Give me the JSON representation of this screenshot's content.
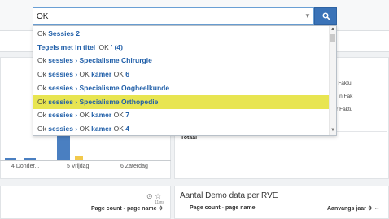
{
  "search": {
    "value": "OK",
    "caret_icon": "chevron-down-icon",
    "button_icon": "search-icon"
  },
  "suggestions": [
    {
      "parts": [
        {
          "t": "Ok ",
          "b": false
        },
        {
          "t": "Sessies 2",
          "b": true
        }
      ]
    },
    {
      "parts": [
        {
          "t": "Tegels met in titel '",
          "b": true
        },
        {
          "t": "OK",
          "b": false
        },
        {
          "t": " ' (4)",
          "b": true
        }
      ]
    },
    {
      "parts": [
        {
          "t": "Ok ",
          "b": false
        },
        {
          "t": "sessies › Specialisme Chirurgie",
          "b": true
        }
      ]
    },
    {
      "parts": [
        {
          "t": "Ok ",
          "b": false
        },
        {
          "t": "sessies › ",
          "b": true
        },
        {
          "t": "OK ",
          "b": false
        },
        {
          "t": "kamer ",
          "b": true
        },
        {
          "t": "OK ",
          "b": false
        },
        {
          "t": "6",
          "b": true
        }
      ]
    },
    {
      "parts": [
        {
          "t": "Ok ",
          "b": false
        },
        {
          "t": "sessies › Specialisme Oogheelkunde",
          "b": true
        }
      ]
    },
    {
      "parts": [
        {
          "t": "Ok ",
          "b": false
        },
        {
          "t": "sessies › Specialisme Orthopedie",
          "b": true
        }
      ],
      "highlighted": true
    },
    {
      "parts": [
        {
          "t": "Ok ",
          "b": false
        },
        {
          "t": "sessies › ",
          "b": true
        },
        {
          "t": "OK ",
          "b": false
        },
        {
          "t": "kamer ",
          "b": true
        },
        {
          "t": "OK ",
          "b": false
        },
        {
          "t": "7",
          "b": true
        }
      ]
    },
    {
      "parts": [
        {
          "t": "Ok ",
          "b": false
        },
        {
          "t": "sessies › ",
          "b": true
        },
        {
          "t": "OK ",
          "b": false
        },
        {
          "t": "kamer ",
          "b": true
        },
        {
          "t": "OK ",
          "b": false
        },
        {
          "t": "4",
          "b": true
        }
      ]
    }
  ],
  "chart": {
    "x_ticks": [
      "4 Donder...",
      "5 Vrijdag",
      "6 Zaterdag"
    ]
  },
  "right_panel": {
    "lines": [
      "rd, DEELS naar Faktu",
      "rd, is verrichting in Fak",
      "rd, nog niet naar Faktu"
    ],
    "total_label": "Totaal"
  },
  "bottom_left": {
    "icons": "⊙ ☆",
    "small_label": "11ms",
    "column_header": "Page count - page name ⇳"
  },
  "bottom_right": {
    "title": "Aantal Demo data per RVE",
    "column1": "Page count - page name",
    "column2": "Aanvangs jaar ⇳ ⇔"
  },
  "colors": {
    "highlight": "#e8e551",
    "link": "#1f5ea8",
    "button": "#3a73b8"
  }
}
